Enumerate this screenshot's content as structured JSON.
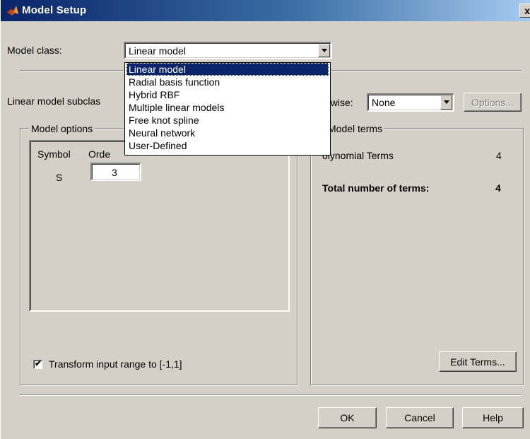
{
  "window": {
    "title": "Model Setup",
    "close_label": "x"
  },
  "model_class": {
    "label": "Model class:",
    "value": "Linear model",
    "options": [
      "Linear model",
      "Radial basis function",
      "Hybrid RBF",
      "Multiple linear models",
      "Free knot spline",
      "Neural network",
      "User-Defined"
    ],
    "selected_index": 0
  },
  "subclass": {
    "label": "Linear model subclas"
  },
  "stepwise": {
    "label": "owise:",
    "value": "None"
  },
  "options_button": "Options...",
  "model_options": {
    "title": "Model options",
    "col_symbol": "Symbol",
    "col_order": "Orde",
    "rows": [
      {
        "symbol": "S",
        "order": "3"
      }
    ]
  },
  "model_terms": {
    "title": "Model terms",
    "polynomial_label": "olynomial Terms",
    "polynomial_value": "4",
    "total_label": "Total number of terms:",
    "total_value": "4"
  },
  "transform": {
    "label": "Transform input range to [-1,1]",
    "checked": true,
    "check_glyph": "✔"
  },
  "buttons": {
    "edit_terms": "Edit Terms...",
    "ok": "OK",
    "cancel": "Cancel",
    "help": "Help"
  }
}
